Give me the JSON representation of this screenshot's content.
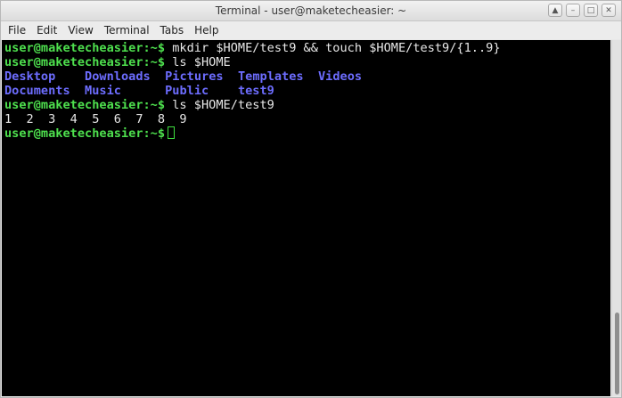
{
  "window": {
    "title": "Terminal - user@maketecheasier: ~",
    "controls": [
      "chevron-up-icon",
      "minimize-icon",
      "maximize-icon",
      "close-icon"
    ]
  },
  "menu": {
    "items": [
      "File",
      "Edit",
      "View",
      "Terminal",
      "Tabs",
      "Help"
    ]
  },
  "terminal": {
    "colors": {
      "prompt": "#4ee04e",
      "directory": "#6d6dff",
      "text": "#e8e8e8",
      "background": "#000000"
    },
    "lines": [
      {
        "prompt": "user@maketecheasier:~$",
        "command": " mkdir $HOME/test9 && touch $HOME/test9/{1..9}"
      },
      {
        "prompt": "user@maketecheasier:~$",
        "command": " ls $HOME"
      },
      {
        "dirs": [
          "Desktop",
          "Downloads",
          "Pictures",
          "Templates",
          "Videos"
        ]
      },
      {
        "dirs": [
          "Documents",
          "Music",
          "Public",
          "test9"
        ]
      },
      {
        "prompt": "user@maketecheasier:~$",
        "command": " ls $HOME/test9"
      },
      {
        "output": "1  2  3  4  5  6  7  8  9"
      },
      {
        "prompt": "user@maketecheasier:~$",
        "command": " "
      }
    ]
  }
}
